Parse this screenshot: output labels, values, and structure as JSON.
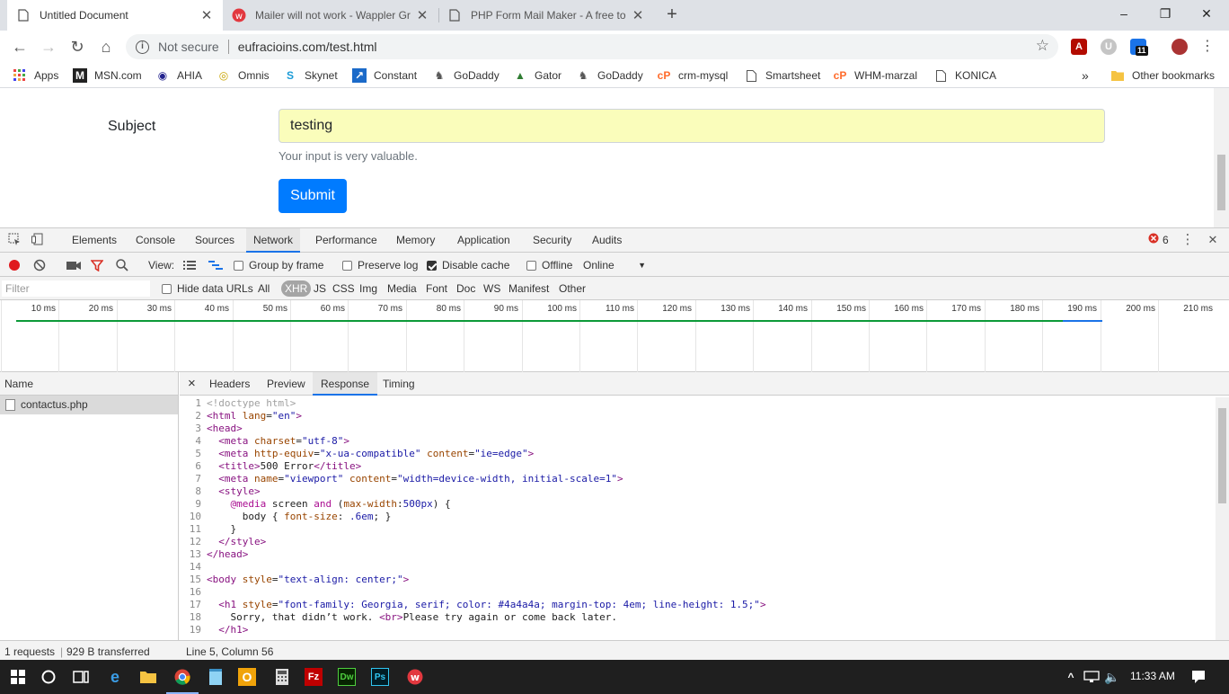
{
  "browser": {
    "tabs": [
      {
        "title": "Untitled Document",
        "active": true
      },
      {
        "title": "Mailer will not work - Wappler Gr",
        "active": false
      },
      {
        "title": "PHP Form Mail Maker - A free to",
        "active": false
      }
    ],
    "new_tab": "+",
    "window_controls": {
      "minimize": "–",
      "maximize": "❐",
      "close": "✕"
    },
    "nav": {
      "back": "←",
      "forward": "→",
      "reload": "↻",
      "home": "⌂"
    },
    "omnibox": {
      "security": "Not secure",
      "url": "eufracioins.com/test.html",
      "star": "☆"
    },
    "extension_badge": "11",
    "menu": "⋮",
    "bookmarks": [
      {
        "label": "Apps",
        "icon": "apps-icon"
      },
      {
        "label": "MSN.com",
        "icon": "msn-icon"
      },
      {
        "label": "AHIA",
        "icon": "ahia-icon"
      },
      {
        "label": "Omnis",
        "icon": "omnis-icon"
      },
      {
        "label": "Skynet",
        "icon": "skynet-icon"
      },
      {
        "label": "Constant",
        "icon": "constant-icon"
      },
      {
        "label": "GoDaddy",
        "icon": "godaddy-icon"
      },
      {
        "label": "Gator",
        "icon": "gator-icon"
      },
      {
        "label": "GoDaddy",
        "icon": "godaddy-icon"
      },
      {
        "label": "crm-mysql",
        "icon": "cpanel-icon"
      },
      {
        "label": "Smartsheet",
        "icon": "page-icon"
      },
      {
        "label": "WHM-marzal",
        "icon": "cpanel-icon"
      },
      {
        "label": "KONICA",
        "icon": "page-icon"
      }
    ],
    "bookmarks_overflow": "»",
    "other_bookmarks": "Other bookmarks"
  },
  "page": {
    "subject_label": "Subject",
    "subject_value": "testing",
    "help_text": "Your input is very valuable.",
    "submit_label": "Submit"
  },
  "devtools": {
    "tabs": [
      "Elements",
      "Console",
      "Sources",
      "Network",
      "Performance",
      "Memory",
      "Application",
      "Security",
      "Audits"
    ],
    "active_tab": "Network",
    "error_count": "6",
    "network_toolbar": {
      "view_label": "View:",
      "group_by_frame": "Group by frame",
      "preserve_log": "Preserve log",
      "disable_cache": "Disable cache",
      "offline": "Offline",
      "throttle": "Online"
    },
    "filter": {
      "placeholder": "Filter",
      "hide_data_urls": "Hide data URLs",
      "types": [
        "All",
        "XHR",
        "JS",
        "CSS",
        "Img",
        "Media",
        "Font",
        "Doc",
        "WS",
        "Manifest",
        "Other"
      ],
      "selected_type": "XHR"
    },
    "timeline_ticks": [
      "10 ms",
      "20 ms",
      "30 ms",
      "40 ms",
      "50 ms",
      "60 ms",
      "70 ms",
      "80 ms",
      "90 ms",
      "100 ms",
      "110 ms",
      "120 ms",
      "130 ms",
      "140 ms",
      "150 ms",
      "160 ms",
      "170 ms",
      "180 ms",
      "190 ms",
      "200 ms",
      "210 ms"
    ],
    "name_header": "Name",
    "requests": [
      {
        "name": "contactus.php"
      }
    ],
    "detail_close": "×",
    "detail_tabs": [
      "Headers",
      "Preview",
      "Response",
      "Timing"
    ],
    "active_detail_tab": "Response",
    "response_lines": [
      {
        "n": "1",
        "html": "<span class='cmt'>&lt;!doctype html&gt;</span>"
      },
      {
        "n": "2",
        "html": "<span class='tag'>&lt;html</span> <span class='attr'>lang</span>=<span class='val'>\"en\"</span><span class='tag'>&gt;</span>"
      },
      {
        "n": "3",
        "html": "<span class='tag'>&lt;head&gt;</span>"
      },
      {
        "n": "4",
        "html": "  <span class='tag'>&lt;meta</span> <span class='attr'>charset</span>=<span class='val'>\"utf-8\"</span><span class='tag'>&gt;</span>"
      },
      {
        "n": "5",
        "html": "  <span class='tag'>&lt;meta</span> <span class='attr'>http-equiv</span>=<span class='val'>\"x-ua-compatible\"</span> <span class='attr'>content</span>=<span class='val'>\"ie=edge\"</span><span class='tag'>&gt;</span>"
      },
      {
        "n": "6",
        "html": "  <span class='tag'>&lt;title&gt;</span>500 Error<span class='tag'>&lt;/title&gt;</span>"
      },
      {
        "n": "7",
        "html": "  <span class='tag'>&lt;meta</span> <span class='attr'>name</span>=<span class='val'>\"viewport\"</span> <span class='attr'>content</span>=<span class='val'>\"width=device-width, initial-scale=1\"</span><span class='tag'>&gt;</span>"
      },
      {
        "n": "8",
        "html": "  <span class='tag'>&lt;style&gt;</span>"
      },
      {
        "n": "9",
        "html": "    <span class='kw'>@media</span> screen <span class='kw'>and</span> (<span class='attr'>max-width</span>:<span class='val'>500px</span>) {"
      },
      {
        "n": "10",
        "html": "      body { <span class='attr'>font-size</span>: <span class='val'>.6em</span>; }"
      },
      {
        "n": "11",
        "html": "    }"
      },
      {
        "n": "12",
        "html": "  <span class='tag'>&lt;/style&gt;</span>"
      },
      {
        "n": "13",
        "html": "<span class='tag'>&lt;/head&gt;</span>"
      },
      {
        "n": "14",
        "html": ""
      },
      {
        "n": "15",
        "html": "<span class='tag'>&lt;body</span> <span class='attr'>style</span>=<span class='val'>\"text-align: center;\"</span><span class='tag'>&gt;</span>"
      },
      {
        "n": "16",
        "html": ""
      },
      {
        "n": "17",
        "html": "  <span class='tag'>&lt;h1</span> <span class='attr'>style</span>=<span class='val'>\"font-family: Georgia, serif; color: #4a4a4a; margin-top: 4em; line-height: 1.5;\"</span><span class='tag'>&gt;</span>"
      },
      {
        "n": "18",
        "html": "    Sorry, that didn’t work. <span class='tag'>&lt;br&gt;</span>Please try again or come back later."
      },
      {
        "n": "19",
        "html": "  <span class='tag'>&lt;/h1&gt;</span>"
      }
    ],
    "status": {
      "requests": "1 requests",
      "transferred": "929 B transferred",
      "cursor": "Line 5, Column 56"
    }
  },
  "taskbar": {
    "time": "11:33 AM"
  },
  "colors": {
    "accent": "#1a73e8",
    "submit": "#007bff",
    "input_bg": "#fafdbb",
    "error": "#d93025"
  }
}
